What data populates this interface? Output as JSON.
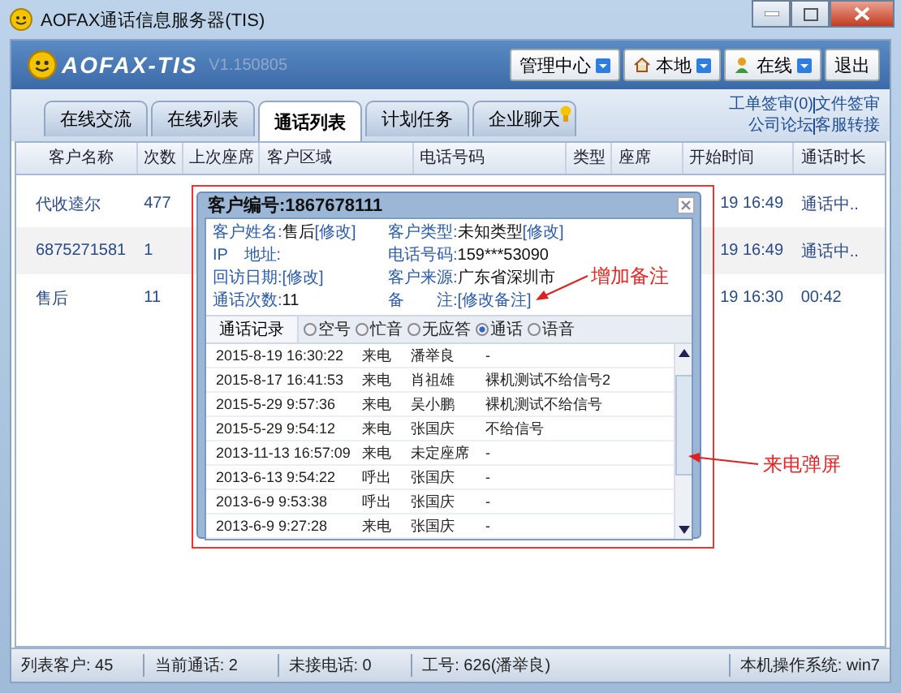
{
  "window": {
    "title": "AOFAX通话信息服务器(TIS)"
  },
  "header": {
    "logo": "AOFAX-TIS",
    "version": "V1.150805",
    "buttons": [
      {
        "label": "管理中心",
        "kind": "menu"
      },
      {
        "label": "本地",
        "kind": "location"
      },
      {
        "label": "在线",
        "kind": "presence"
      },
      {
        "label": "退出",
        "kind": "plain"
      }
    ]
  },
  "tabs": [
    {
      "label": "在线交流",
      "selected": false,
      "alert": false
    },
    {
      "label": "在线列表",
      "selected": false,
      "alert": false
    },
    {
      "label": "通话列表",
      "selected": true,
      "alert": false
    },
    {
      "label": "计划任务",
      "selected": false,
      "alert": false
    },
    {
      "label": "企业聊天",
      "selected": false,
      "alert": true
    }
  ],
  "links": [
    [
      "工单签审(0)",
      "文件签审"
    ],
    [
      "公司论坛",
      "客服转接"
    ]
  ],
  "table": {
    "columns": [
      "客户名称",
      "次数",
      "上次座席",
      "客户区域",
      "电话号码",
      "类型",
      "座席",
      "开始时间",
      "通话时长"
    ],
    "rows": [
      {
        "name": "代收逵尔",
        "count": "477",
        "start_time": "19 16:49",
        "duration": "通话中.."
      },
      {
        "name": "6875271581",
        "count": "1",
        "start_time": "19 16:49",
        "duration": "通话中.."
      },
      {
        "name": "售后",
        "count": "11",
        "start_time": "19 16:30",
        "duration": "00:42"
      }
    ]
  },
  "popup": {
    "title": "客户编号:1867678111",
    "fields": [
      {
        "label": "客户姓名:",
        "value": "售后",
        "link": "[修改]"
      },
      {
        "label": "客户类型:",
        "value": "未知类型",
        "link": "[修改]"
      },
      {
        "label": "IP　地址:"
      },
      {
        "label": "电话号码:",
        "value": "159***53090"
      },
      {
        "label": "回访日期:",
        "link": "[修改]"
      },
      {
        "label": "客户来源:",
        "value": "广东省深圳市"
      },
      {
        "label": "通话次数:",
        "value": "11"
      },
      {
        "label": "备　　注:",
        "link": "[修改备注]"
      }
    ],
    "record_tab": "通话记录",
    "filters": [
      {
        "label": "空号",
        "selected": false
      },
      {
        "label": "忙音",
        "selected": false
      },
      {
        "label": "无应答",
        "selected": false
      },
      {
        "label": "通话",
        "selected": true
      },
      {
        "label": "语音",
        "selected": false
      }
    ],
    "records": [
      {
        "time": "2015-8-19 16:30:22",
        "direction": "来电",
        "agent": "潘举良",
        "note": "-"
      },
      {
        "time": "2015-8-17 16:41:53",
        "direction": "来电",
        "agent": "肖祖雄",
        "note": "裸机测试不给信号2"
      },
      {
        "time": "2015-5-29 9:57:36",
        "direction": "来电",
        "agent": "吴小鹏",
        "note": "裸机测试不给信号"
      },
      {
        "time": "2015-5-29 9:54:12",
        "direction": "来电",
        "agent": "张国庆",
        "note": "不给信号"
      },
      {
        "time": "2013-11-13 16:57:09",
        "direction": "来电",
        "agent": "未定座席",
        "note": "-"
      },
      {
        "time": "2013-6-13 9:54:22",
        "direction": "呼出",
        "agent": "张国庆",
        "note": "-"
      },
      {
        "time": "2013-6-9 9:53:38",
        "direction": "呼出",
        "agent": "张国庆",
        "note": "-"
      },
      {
        "time": "2013-6-9 9:27:28",
        "direction": "来电",
        "agent": "张国庆",
        "note": "-"
      }
    ]
  },
  "annotations": [
    "增加备注",
    "来电弹屏"
  ],
  "status_bar": [
    "列表客户: 45",
    "当前通话: 2",
    "未接电话: 0",
    "工号: 626(潘举良)",
    "本机操作系统: win7"
  ]
}
